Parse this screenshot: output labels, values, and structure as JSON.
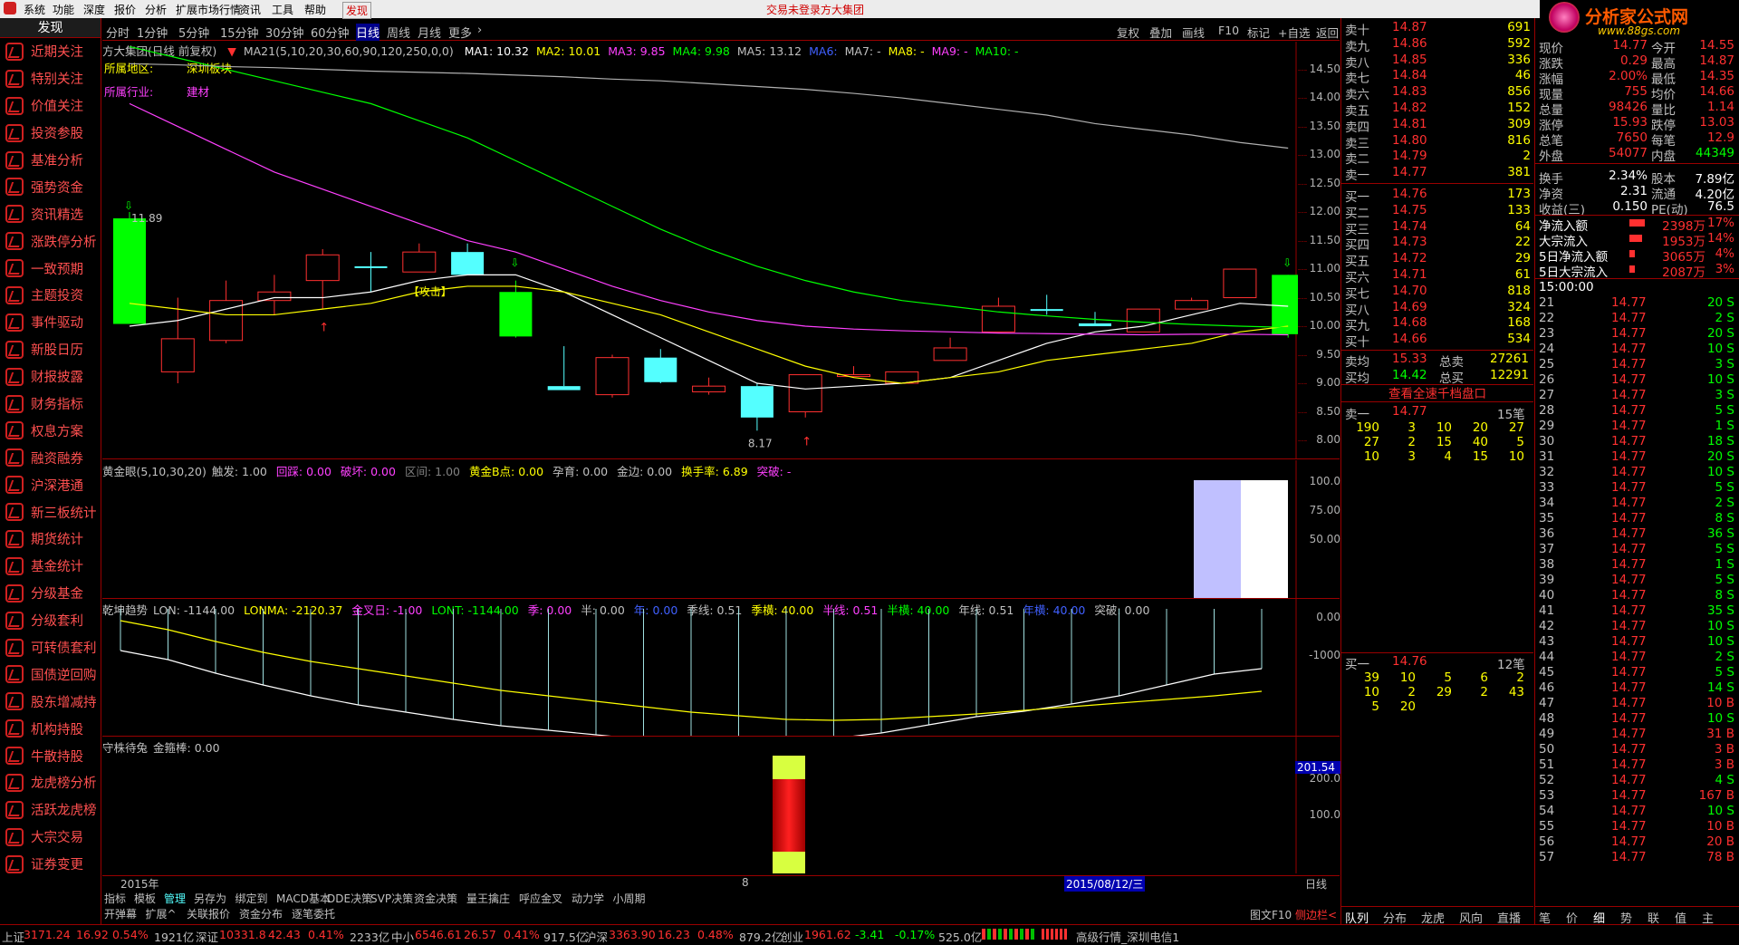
{
  "menu": {
    "items": [
      "系统",
      "功能",
      "深度",
      "报价",
      "分析",
      "扩展市场行情",
      "资讯",
      "工具",
      "帮助",
      "发现"
    ],
    "notice_login": "交易未登录",
    "notice_stock": "方大集团"
  },
  "logo": {
    "text": "分析家公式网",
    "url_text": "www.88gs.com"
  },
  "sidebar": {
    "header": "发现",
    "items": [
      "近期关注",
      "特别关注",
      "价值关注",
      "投资参股",
      "基准分析",
      "强势资金",
      "资讯精选",
      "涨跌停分析",
      "一致预期",
      "主题投资",
      "事件驱动",
      "新股日历",
      "财报披露",
      "财务指标",
      "权息方案",
      "融资融券",
      "沪深港通",
      "新三板统计",
      "期货统计",
      "基金统计",
      "分级基金",
      "分级套利",
      "可转债套利",
      "国债逆回购",
      "股东增减持",
      "机构持股",
      "牛散持股",
      "龙虎榜分析",
      "活跃龙虎榜",
      "大宗交易",
      "证券变更"
    ]
  },
  "periods": [
    "分时",
    "1分钟",
    "5分钟",
    "15分钟",
    "30分钟",
    "60分钟",
    "日线",
    "周线",
    "月线",
    "更多"
  ],
  "active_period": "日线",
  "toolbar": [
    "复权",
    "叠加",
    "画线",
    "F10",
    "标记",
    "+自选",
    "返回"
  ],
  "main": {
    "title": "方大集团(日线 前复权)",
    "ma_label": "MA21(5,10,20,30,60,90,120,250,0,0)",
    "ma_values": [
      {
        "label": "MA1: 10.32",
        "color": "#ffffff"
      },
      {
        "label": "MA2: 10.01",
        "color": "#ffff00"
      },
      {
        "label": "MA3: 9.85",
        "color": "#ff40ff"
      },
      {
        "label": "MA4: 9.98",
        "color": "#00ff00"
      },
      {
        "label": "MA5: 13.12",
        "color": "#c0c0c0"
      },
      {
        "label": "MA6:",
        "color": "#4060ff"
      },
      {
        "label": "MA7: -",
        "color": "#c0c0c0"
      },
      {
        "label": "MA8: -",
        "color": "#ffff00"
      },
      {
        "label": "MA9: -",
        "color": "#ff40ff"
      },
      {
        "label": "MA10: -",
        "color": "#00ff00"
      }
    ],
    "region_label": "所属地区:",
    "region_value": "深圳板块",
    "industry_label": "所属行业:",
    "industry_value": "建材",
    "attack_label": "【攻击】",
    "high_label": "11.89",
    "low_label": "8.17",
    "y_ticks": [
      "14.50",
      "14.00",
      "13.50",
      "13.00",
      "12.50",
      "12.00",
      "11.50",
      "11.00",
      "10.50",
      "10.00",
      "9.50",
      "9.00",
      "8.50",
      "8.00"
    ]
  },
  "chart_data": {
    "type": "candlestick",
    "dates_shown": [
      "2015年",
      "8",
      "2015/08/12/三"
    ],
    "candles": [
      {
        "o": 10.04,
        "h": 12.0,
        "l": 10.04,
        "c": 11.89,
        "color": "green"
      },
      {
        "o": 9.2,
        "h": 10.5,
        "l": 9.0,
        "c": 9.78,
        "color": "red"
      },
      {
        "o": 9.75,
        "h": 10.8,
        "l": 9.7,
        "c": 10.45,
        "color": "red"
      },
      {
        "o": 10.45,
        "h": 10.9,
        "l": 10.2,
        "c": 10.6,
        "color": "red"
      },
      {
        "o": 10.8,
        "h": 11.35,
        "l": 10.3,
        "c": 11.25,
        "color": "red"
      },
      {
        "o": 11.05,
        "h": 11.3,
        "l": 10.6,
        "c": 11.05,
        "color": "cyan"
      },
      {
        "o": 10.95,
        "h": 11.45,
        "l": 10.95,
        "c": 11.3,
        "color": "red"
      },
      {
        "o": 11.3,
        "h": 11.45,
        "l": 10.9,
        "c": 10.9,
        "color": "cyan"
      },
      {
        "o": 10.6,
        "h": 10.8,
        "l": 9.8,
        "c": 9.82,
        "color": "green"
      },
      {
        "o": 8.95,
        "h": 9.65,
        "l": 8.95,
        "c": 8.88,
        "color": "cyan"
      },
      {
        "o": 8.8,
        "h": 9.5,
        "l": 8.75,
        "c": 9.45,
        "color": "red"
      },
      {
        "o": 9.45,
        "h": 9.6,
        "l": 9.0,
        "c": 9.02,
        "color": "cyan"
      },
      {
        "o": 8.85,
        "h": 9.1,
        "l": 8.8,
        "c": 8.95,
        "color": "red"
      },
      {
        "o": 8.95,
        "h": 9.0,
        "l": 8.17,
        "c": 8.4,
        "color": "cyan"
      },
      {
        "o": 8.5,
        "h": 9.15,
        "l": 8.4,
        "c": 9.15,
        "color": "red"
      },
      {
        "o": 9.15,
        "h": 9.3,
        "l": 9.1,
        "c": 9.15,
        "color": "red"
      },
      {
        "o": 9.0,
        "h": 9.2,
        "l": 9.0,
        "c": 9.2,
        "color": "red"
      },
      {
        "o": 9.4,
        "h": 9.8,
        "l": 9.4,
        "c": 9.62,
        "color": "red"
      },
      {
        "o": 9.9,
        "h": 10.5,
        "l": 9.9,
        "c": 10.35,
        "color": "red"
      },
      {
        "o": 10.3,
        "h": 10.55,
        "l": 10.2,
        "c": 10.3,
        "color": "cyan"
      },
      {
        "o": 10.05,
        "h": 10.25,
        "l": 10.0,
        "c": 10.0,
        "color": "cyan"
      },
      {
        "o": 9.9,
        "h": 10.3,
        "l": 9.9,
        "c": 10.3,
        "color": "red"
      },
      {
        "o": 10.3,
        "h": 10.5,
        "l": 10.3,
        "c": 10.45,
        "color": "red"
      },
      {
        "o": 10.5,
        "h": 11.0,
        "l": 10.5,
        "c": 11.0,
        "color": "red"
      },
      {
        "o": 10.9,
        "h": 10.9,
        "l": 9.8,
        "c": 9.86,
        "color": "green"
      }
    ],
    "ylim": [
      8.0,
      14.7
    ]
  },
  "ind1": {
    "title": "黄金眼(5,10,30,20)",
    "items": [
      {
        "label": "触发: 1.00",
        "color": "#c0c0c0"
      },
      {
        "label": "回踩: 0.00",
        "color": "#ff40ff"
      },
      {
        "label": "破坏: 0.00",
        "color": "#ff40ff"
      },
      {
        "label": "区间: 1.00",
        "color": "#808080"
      },
      {
        "label": "黄金B点: 0.00",
        "color": "#ffff00"
      },
      {
        "label": "孕育: 0.00",
        "color": "#c0c0c0"
      },
      {
        "label": "金边: 0.00",
        "color": "#c0c0c0"
      },
      {
        "label": "换手率: 6.89",
        "color": "#ffff00"
      },
      {
        "label": "突破: -",
        "color": "#ff40ff"
      }
    ],
    "y_ticks": [
      "100.0",
      "75.00",
      "50.00"
    ]
  },
  "ind2": {
    "title": "乾坤趋势",
    "items": [
      {
        "label": "LON: -1144.00",
        "color": "#c0c0c0"
      },
      {
        "label": "LONMA: -2120.37",
        "color": "#ffff00"
      },
      {
        "label": "金叉日: -1.00",
        "color": "#ff40ff"
      },
      {
        "label": "LONT: -1144.00",
        "color": "#00ff00"
      },
      {
        "label": "季: 0.00",
        "color": "#ff40ff"
      },
      {
        "label": "半: 0.00",
        "color": "#c0c0c0"
      },
      {
        "label": "年: 0.00",
        "color": "#4060ff"
      },
      {
        "label": "季线: 0.51",
        "color": "#c0c0c0"
      },
      {
        "label": "季横: 40.00",
        "color": "#ffff00"
      },
      {
        "label": "半线: 0.51",
        "color": "#ff40ff"
      },
      {
        "label": "半横: 40.00",
        "color": "#00ff00"
      },
      {
        "label": "年线: 0.51",
        "color": "#c0c0c0"
      },
      {
        "label": "年横: 40.00",
        "color": "#4060ff"
      },
      {
        "label": "突破: 0.00",
        "color": "#c0c0c0"
      }
    ],
    "y_ticks": [
      "0.00",
      "-1000"
    ]
  },
  "ind3": {
    "title": "守株待兔",
    "items": [
      {
        "label": "金箍棒: 0.00",
        "color": "#c0c0c0"
      }
    ],
    "y_ticks": [
      "200.0",
      "100.0"
    ],
    "cursor_value": "201.54"
  },
  "xaxis": {
    "left": "2015年",
    "mid": "8",
    "cursor": "2015/08/12/三",
    "right": "日线"
  },
  "bottom_tabs_row1": [
    "指标",
    "模板",
    "管理",
    "另存为",
    "绑定到",
    "MACD基本",
    "DDE决策",
    "SVP决策",
    "资金决策",
    "量王擒庄",
    "呼应金叉",
    "动力学",
    "小周期"
  ],
  "bottom_tabs_row2": [
    "开弹幕",
    "扩展^",
    "关联报价",
    "资金分布",
    "逐笔委托"
  ],
  "bottom_right": [
    "图文F10",
    "侧边栏<"
  ],
  "orderbook": {
    "asks": [
      {
        "label": "卖十",
        "price": "14.87",
        "vol": "691"
      },
      {
        "label": "卖九",
        "price": "14.86",
        "vol": "592"
      },
      {
        "label": "卖八",
        "price": "14.85",
        "vol": "336"
      },
      {
        "label": "卖七",
        "price": "14.84",
        "vol": "46"
      },
      {
        "label": "卖六",
        "price": "14.83",
        "vol": "856"
      },
      {
        "label": "卖五",
        "price": "14.82",
        "vol": "152"
      },
      {
        "label": "卖四",
        "price": "14.81",
        "vol": "309"
      },
      {
        "label": "卖三",
        "price": "14.80",
        "vol": "816"
      },
      {
        "label": "卖二",
        "price": "14.79",
        "vol": "2"
      },
      {
        "label": "卖一",
        "price": "14.77",
        "vol": "381"
      }
    ],
    "bids": [
      {
        "label": "买一",
        "price": "14.76",
        "vol": "173"
      },
      {
        "label": "买二",
        "price": "14.75",
        "vol": "133"
      },
      {
        "label": "买三",
        "price": "14.74",
        "vol": "64"
      },
      {
        "label": "买四",
        "price": "14.73",
        "vol": "22"
      },
      {
        "label": "买五",
        "price": "14.72",
        "vol": "29"
      },
      {
        "label": "买六",
        "price": "14.71",
        "vol": "61"
      },
      {
        "label": "买七",
        "price": "14.70",
        "vol": "818"
      },
      {
        "label": "买八",
        "price": "14.69",
        "vol": "324"
      },
      {
        "label": "买九",
        "price": "14.68",
        "vol": "168"
      },
      {
        "label": "买十",
        "price": "14.66",
        "vol": "534"
      }
    ],
    "avg_sell_label": "卖均",
    "avg_sell": "15.33",
    "total_sell_label": "总卖",
    "total_sell": "27261",
    "avg_buy_label": "买均",
    "avg_buy": "14.42",
    "total_buy_label": "总买",
    "total_buy": "12291",
    "full_depth": "查看全速千档盘口",
    "sell1_label": "卖一",
    "sell1_price": "14.77",
    "sell1_count": "15笔",
    "sell1_queue": [
      [
        "190",
        "3",
        "10",
        "20",
        "27"
      ],
      [
        "27",
        "2",
        "15",
        "40",
        "5"
      ],
      [
        "10",
        "3",
        "4",
        "15",
        "10"
      ]
    ],
    "buy1_label": "买一",
    "buy1_price": "14.76",
    "buy1_count": "12笔",
    "buy1_queue": [
      [
        "39",
        "10",
        "5",
        "6",
        "2"
      ],
      [
        "10",
        "2",
        "29",
        "2",
        "43"
      ],
      [
        "5",
        "20"
      ]
    ]
  },
  "quote": {
    "rows": [
      [
        "现价",
        "14.77",
        "今开",
        "14.55"
      ],
      [
        "涨跌",
        "0.29",
        "最高",
        "14.87"
      ],
      [
        "涨幅",
        "2.00%",
        "最低",
        "14.35"
      ],
      [
        "现量",
        "755",
        "均价",
        "14.66"
      ],
      [
        "总量",
        "98426",
        "量比",
        "1.14"
      ],
      [
        "涨停",
        "15.93",
        "跌停",
        "13.03"
      ],
      [
        "总笔",
        "7650",
        "每笔",
        "12.9"
      ],
      [
        "外盘",
        "54077",
        "内盘",
        "44349"
      ],
      [
        "换手",
        "2.34%",
        "股本",
        "7.89亿"
      ],
      [
        "净资",
        "2.31",
        "流通",
        "4.20亿"
      ],
      [
        "收益(三)",
        "0.150",
        "PE(动)",
        "76.5"
      ]
    ],
    "flows": [
      {
        "label": "净流入额",
        "value": "2398万",
        "pct": "17%",
        "bar": 0.17
      },
      {
        "label": "大宗流入",
        "value": "1953万",
        "pct": "14%",
        "bar": 0.14
      },
      {
        "label": "5日净流入额",
        "value": "3065万",
        "pct": "4%",
        "bar": 0.04
      },
      {
        "label": "5日大宗流入",
        "value": "2087万",
        "pct": "3%",
        "bar": 0.03
      }
    ],
    "ticks_header": "15:00:00",
    "ticks": [
      [
        "21",
        "14.77",
        "20 S"
      ],
      [
        "22",
        "14.77",
        "2 S"
      ],
      [
        "23",
        "14.77",
        "20 S"
      ],
      [
        "24",
        "14.77",
        "10 S"
      ],
      [
        "25",
        "14.77",
        "3 S"
      ],
      [
        "26",
        "14.77",
        "10 S"
      ],
      [
        "27",
        "14.77",
        "3 S"
      ],
      [
        "28",
        "14.77",
        "5 S"
      ],
      [
        "29",
        "14.77",
        "1 S"
      ],
      [
        "30",
        "14.77",
        "18 S"
      ],
      [
        "31",
        "14.77",
        "20 S"
      ],
      [
        "32",
        "14.77",
        "10 S"
      ],
      [
        "33",
        "14.77",
        "5 S"
      ],
      [
        "34",
        "14.77",
        "2 S"
      ],
      [
        "35",
        "14.77",
        "8 S"
      ],
      [
        "36",
        "14.77",
        "36 S"
      ],
      [
        "37",
        "14.77",
        "5 S"
      ],
      [
        "38",
        "14.77",
        "1 S"
      ],
      [
        "39",
        "14.77",
        "5 S"
      ],
      [
        "40",
        "14.77",
        "8 S"
      ],
      [
        "41",
        "14.77",
        "35 S"
      ],
      [
        "42",
        "14.77",
        "10 S"
      ],
      [
        "43",
        "14.77",
        "10 S"
      ],
      [
        "44",
        "14.77",
        "2 S"
      ],
      [
        "45",
        "14.77",
        "5 S"
      ],
      [
        "46",
        "14.77",
        "14 S"
      ],
      [
        "47",
        "14.77",
        "10 B"
      ],
      [
        "48",
        "14.77",
        "10 S"
      ],
      [
        "49",
        "14.77",
        "31 B"
      ],
      [
        "50",
        "14.77",
        "3 B"
      ],
      [
        "51",
        "14.77",
        "3 B"
      ],
      [
        "52",
        "14.77",
        "4 S"
      ],
      [
        "53",
        "14.77",
        "167 B"
      ],
      [
        "54",
        "14.77",
        "10 S"
      ],
      [
        "55",
        "14.77",
        "10 B"
      ],
      [
        "56",
        "14.77",
        "20 B"
      ],
      [
        "57",
        "14.77",
        "78 B"
      ]
    ]
  },
  "panel_tabs_left": [
    "队列",
    "分布",
    "龙虎",
    "风向",
    "直播"
  ],
  "panel_tabs_right": [
    "笔",
    "价",
    "细",
    "势",
    "联",
    "值",
    "主"
  ],
  "status": {
    "sh_label": "上证",
    "sh": "3171.24",
    "sh_chg": "16.92",
    "sh_pct": "0.54%",
    "sh_amt": "1921亿",
    "sz_label": "深证",
    "sz": "10331.8",
    "sz_chg": "42.43",
    "sz_pct": "0.41%",
    "sz_amt": "2233亿",
    "zx_label": "中小",
    "zx": "6546.61",
    "zx_chg": "26.57",
    "zx_pct": "0.41%",
    "zx_amt": "917.5亿",
    "hs_label": "沪深",
    "hs": "3363.90",
    "hs_chg": "16.23",
    "hs_pct": "0.48%",
    "hs_amt": "879.2亿",
    "cy_label": "创业",
    "cy": "1961.62",
    "cy_chg": "-3.41",
    "cy_pct": "-0.17%",
    "cy_amt": "525.0亿",
    "server": "高级行情_深圳电信1"
  }
}
